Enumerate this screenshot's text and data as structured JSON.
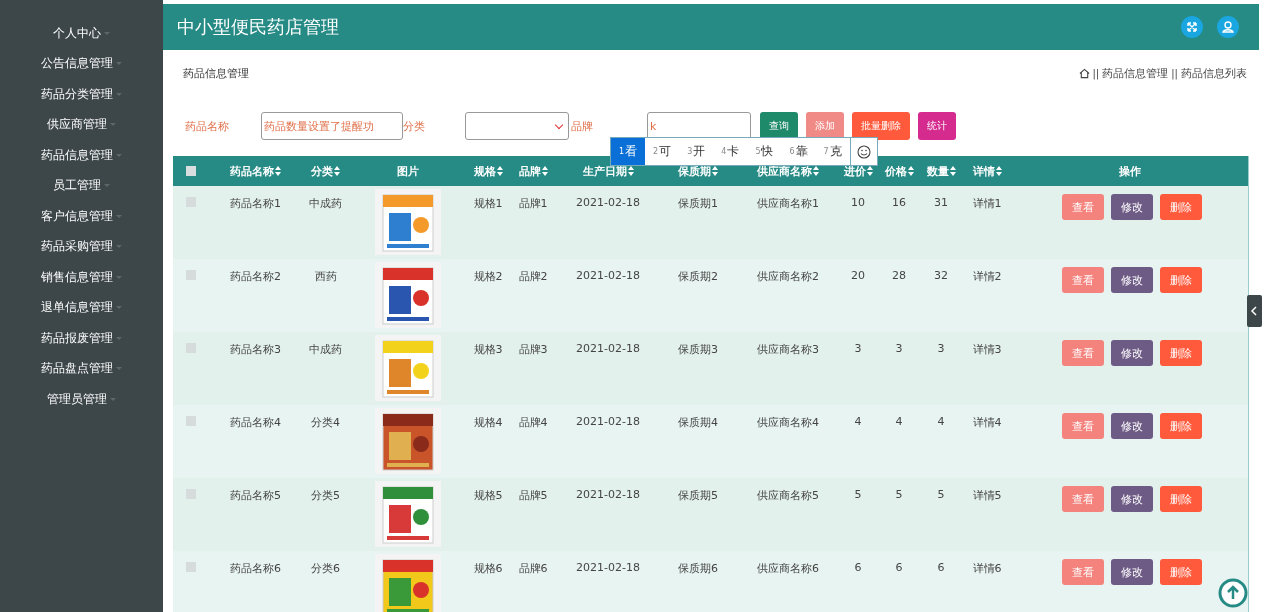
{
  "sidebar": {
    "items": [
      {
        "label": "个人中心"
      },
      {
        "label": "公告信息管理"
      },
      {
        "label": "药品分类管理"
      },
      {
        "label": "供应商管理"
      },
      {
        "label": "药品信息管理"
      },
      {
        "label": "员工管理"
      },
      {
        "label": "客户信息管理"
      },
      {
        "label": "药品采购管理"
      },
      {
        "label": "销售信息管理"
      },
      {
        "label": "退单信息管理"
      },
      {
        "label": "药品报废管理"
      },
      {
        "label": "药品盘点管理"
      },
      {
        "label": "管理员管理"
      }
    ]
  },
  "header": {
    "title": "中小型便民药店管理"
  },
  "page": {
    "title": "药品信息管理",
    "breadcrumb": {
      "separator": "||",
      "items": [
        "药品信息管理",
        "药品信息列表"
      ]
    }
  },
  "search": {
    "fields": [
      {
        "label": "药品名称",
        "kind": "input",
        "value": "药品数量设置了提醒功"
      },
      {
        "label": "分类",
        "kind": "select"
      },
      {
        "label": "品牌",
        "kind": "input",
        "value": "k"
      }
    ],
    "buttons": [
      {
        "label": "查询",
        "color": "#1e8a6a"
      },
      {
        "label": "添加",
        "color": "#f08a86"
      },
      {
        "label": "批量删除",
        "color": "#ff5a3c"
      },
      {
        "label": "统计",
        "color": "#d52a8e"
      }
    ]
  },
  "ime": {
    "candidates": [
      {
        "index": "1",
        "label": "看",
        "selected": true
      },
      {
        "index": "2",
        "label": "可",
        "selected": false
      },
      {
        "index": "3",
        "label": "开",
        "selected": false
      },
      {
        "index": "4",
        "label": "卡",
        "selected": false
      },
      {
        "index": "5",
        "label": "快",
        "selected": false
      },
      {
        "index": "6",
        "label": "靠",
        "selected": false
      },
      {
        "index": "7",
        "label": "克",
        "selected": false
      }
    ]
  },
  "table": {
    "select_all": {
      "checked": false
    },
    "columns": [
      {
        "label": "药品名称",
        "sortable": true
      },
      {
        "label": "分类",
        "sortable": true
      },
      {
        "label": "图片",
        "sortable": false
      },
      {
        "label": "规格",
        "sortable": true
      },
      {
        "label": "品牌",
        "sortable": true
      },
      {
        "label": "生产日期",
        "sortable": true
      },
      {
        "label": "保质期",
        "sortable": true
      },
      {
        "label": "供应商名称",
        "sortable": true
      },
      {
        "label": "进价",
        "sortable": true
      },
      {
        "label": "价格",
        "sortable": true
      },
      {
        "label": "数量",
        "sortable": true
      },
      {
        "label": "详情",
        "sortable": true
      },
      {
        "label": "操作",
        "sortable": false
      }
    ],
    "rows": [
      {
        "checked": false,
        "cells": [
          "药品名称1",
          "中成药",
          {
            "kind": "picture"
          },
          "规格1",
          "品牌1",
          "2021-02-18",
          "保质期1",
          "供应商名称1",
          "10",
          "16",
          "31",
          "详情1"
        ],
        "actions": [
          {
            "label": "查看",
            "color": "#f4837d"
          },
          {
            "label": "修改",
            "color": "#6d5a85"
          },
          {
            "label": "删除",
            "color": "#ff5a3c"
          }
        ]
      },
      {
        "checked": false,
        "cells": [
          "药品名称2",
          "西药",
          {
            "kind": "picture"
          },
          "规格2",
          "品牌2",
          "2021-02-18",
          "保质期2",
          "供应商名称2",
          "20",
          "28",
          "32",
          "详情2"
        ],
        "actions": [
          {
            "label": "查看",
            "color": "#f4837d"
          },
          {
            "label": "修改",
            "color": "#6d5a85"
          },
          {
            "label": "删除",
            "color": "#ff5a3c"
          }
        ]
      },
      {
        "checked": false,
        "cells": [
          "药品名称3",
          "中成药",
          {
            "kind": "picture"
          },
          "规格3",
          "品牌3",
          "2021-02-18",
          "保质期3",
          "供应商名称3",
          "3",
          "3",
          "3",
          "详情3"
        ],
        "actions": [
          {
            "label": "查看",
            "color": "#f4837d"
          },
          {
            "label": "修改",
            "color": "#6d5a85"
          },
          {
            "label": "删除",
            "color": "#ff5a3c"
          }
        ]
      },
      {
        "checked": false,
        "cells": [
          "药品名称4",
          "分类4",
          {
            "kind": "picture"
          },
          "规格4",
          "品牌4",
          "2021-02-18",
          "保质期4",
          "供应商名称4",
          "4",
          "4",
          "4",
          "详情4"
        ],
        "actions": [
          {
            "label": "查看",
            "color": "#f4837d"
          },
          {
            "label": "修改",
            "color": "#6d5a85"
          },
          {
            "label": "删除",
            "color": "#ff5a3c"
          }
        ]
      },
      {
        "checked": false,
        "cells": [
          "药品名称5",
          "分类5",
          {
            "kind": "picture"
          },
          "规格5",
          "品牌5",
          "2021-02-18",
          "保质期5",
          "供应商名称5",
          "5",
          "5",
          "5",
          "详情5"
        ],
        "actions": [
          {
            "label": "查看",
            "color": "#f4837d"
          },
          {
            "label": "修改",
            "color": "#6d5a85"
          },
          {
            "label": "删除",
            "color": "#ff5a3c"
          }
        ]
      },
      {
        "checked": false,
        "cells": [
          "药品名称6",
          "分类6",
          {
            "kind": "picture"
          },
          "规格6",
          "品牌6",
          "2021-02-18",
          "保质期6",
          "供应商名称6",
          "6",
          "6",
          "6",
          "详情6"
        ],
        "actions": [
          {
            "label": "查看",
            "color": "#f4837d"
          },
          {
            "label": "修改",
            "color": "#6d5a85"
          },
          {
            "label": "删除",
            "color": "#ff5a3c"
          }
        ]
      }
    ]
  }
}
